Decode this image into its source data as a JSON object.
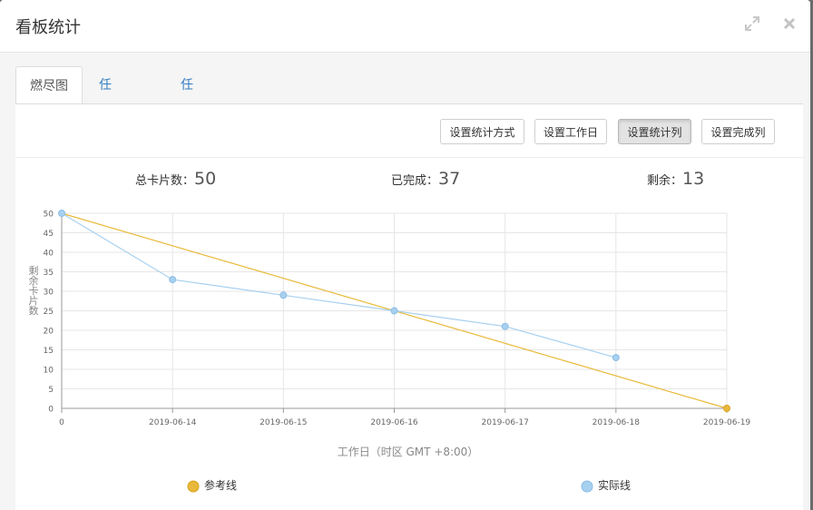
{
  "dialog": {
    "title": "看板统计",
    "icons": {
      "expand": "expand-icon",
      "close": "close-icon"
    }
  },
  "tabs": [
    {
      "label": "燃尽图",
      "active": true
    },
    {
      "label": "任务分布",
      "active": false
    },
    {
      "label": "任务周期",
      "active": false
    }
  ],
  "toolbar": {
    "buttons": [
      {
        "label": "设置统计方式",
        "pressed": false
      },
      {
        "label": "设置工作日",
        "pressed": false
      },
      {
        "label": "设置统计列",
        "pressed": true
      },
      {
        "label": "设置完成列",
        "pressed": false
      }
    ]
  },
  "stats": {
    "total_label": "总卡片数：",
    "total_value": "50",
    "done_label": "已完成：",
    "done_value": "37",
    "remain_label": "剩余：",
    "remain_value": "13"
  },
  "chart_data": {
    "type": "line",
    "xlabel": "工作日（时区 GMT +8:00）",
    "ylabel": "剩余卡片数",
    "categories": [
      "0",
      "2019-06-14",
      "2019-06-15",
      "2019-06-16",
      "2019-06-17",
      "2019-06-18",
      "2019-06-19"
    ],
    "ylim": [
      0,
      50
    ],
    "yticks": [
      0,
      5,
      10,
      15,
      20,
      25,
      30,
      35,
      40,
      45,
      50
    ],
    "grid": true,
    "legend_position": "bottom",
    "series": [
      {
        "name": "参考线",
        "color": "#e8b93a",
        "values": [
          50,
          null,
          null,
          null,
          null,
          null,
          0
        ]
      },
      {
        "name": "实际线",
        "color": "#a7d0ef",
        "values": [
          50,
          33,
          29,
          25,
          21,
          13,
          null
        ]
      }
    ]
  }
}
